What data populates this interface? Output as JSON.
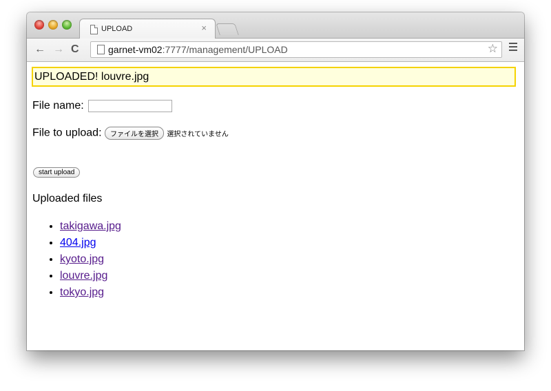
{
  "browser": {
    "tab_title": "UPLOAD",
    "tab_close": "×",
    "url_host": "garnet-vm02",
    "url_rest": ":7777/management/UPLOAD",
    "back_icon": "←",
    "forward_icon": "→",
    "reload_icon": "C",
    "star_icon": "☆"
  },
  "page": {
    "alert_text": "UPLOADED! louvre.jpg",
    "file_name_label": "File name:",
    "file_name_value": "",
    "file_to_upload_label": "File to upload:",
    "choose_file_button": "ファイルを選択",
    "no_file_selected": "選択されていません",
    "start_upload_button": "start upload",
    "uploaded_heading": "Uploaded files",
    "uploaded_files": [
      "takigawa.jpg",
      "404.jpg",
      "kyoto.jpg",
      "louvre.jpg",
      "tokyo.jpg"
    ]
  },
  "colors": {
    "alert_background": "#ffffdd",
    "alert_border": "#f5d300",
    "visited_link": "#551a8b",
    "unvisited_link": "#0000ee"
  }
}
